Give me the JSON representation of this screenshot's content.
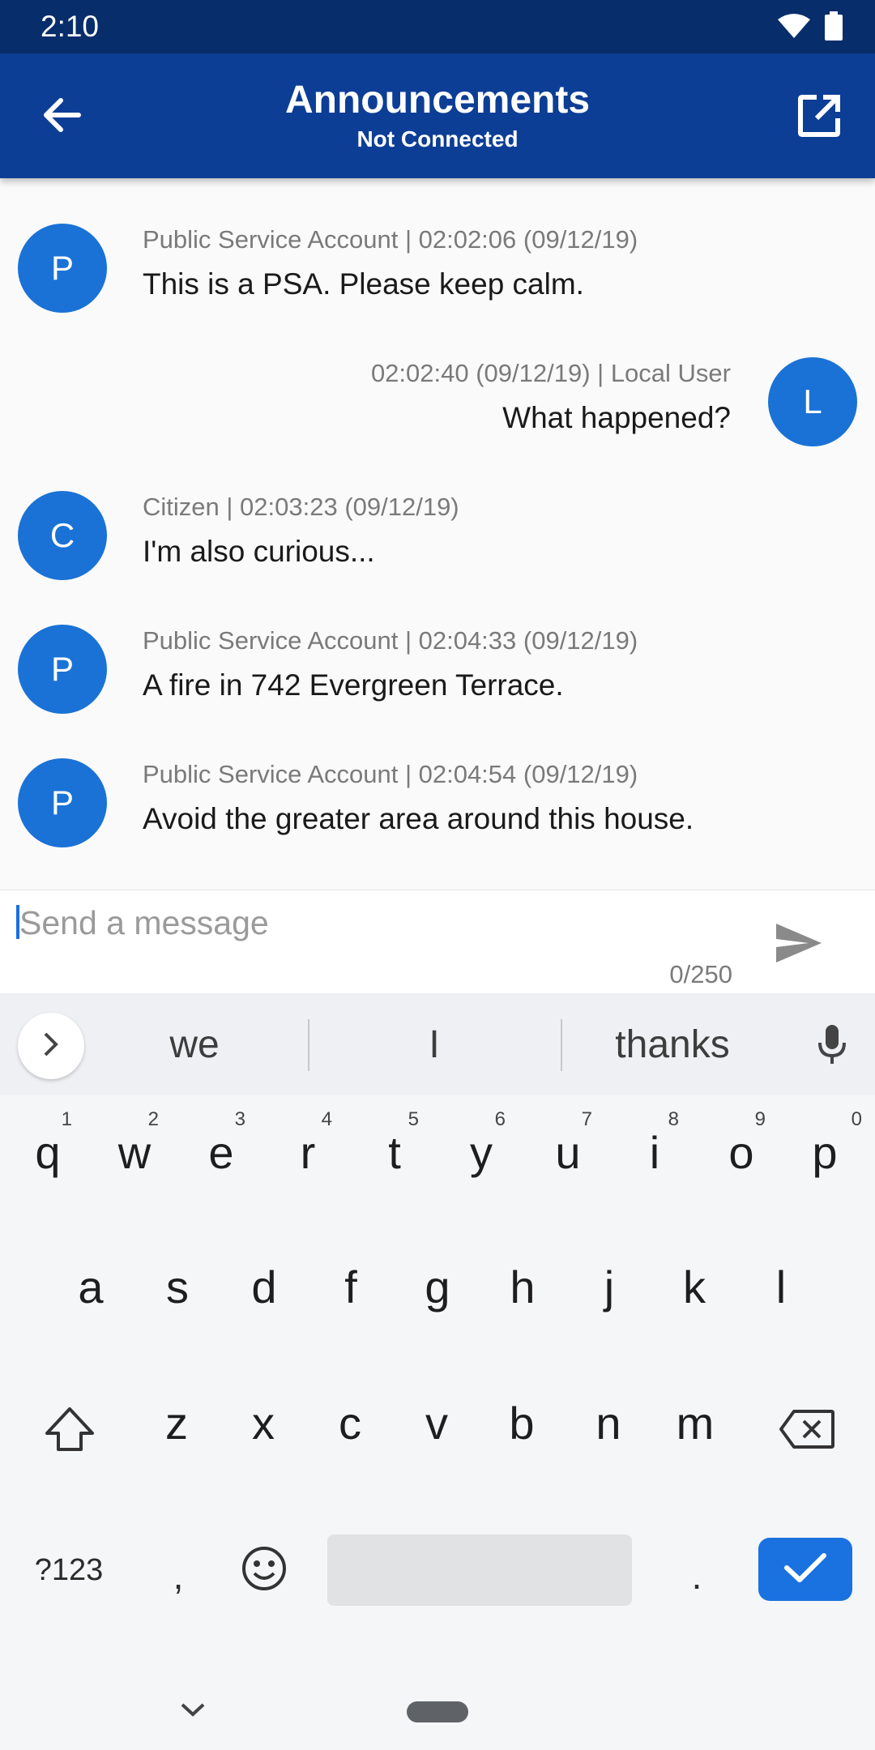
{
  "status_bar": {
    "time": "2:10"
  },
  "app_bar": {
    "title": "Announcements",
    "subtitle": "Not Connected"
  },
  "messages": [
    {
      "side": "left",
      "avatar": "P",
      "meta": "Public Service Account | 02:02:06 (09/12/19)",
      "text": "This is a PSA. Please keep calm."
    },
    {
      "side": "right",
      "avatar": "L",
      "meta": "02:02:40 (09/12/19) | Local User",
      "text": "What happened?"
    },
    {
      "side": "left",
      "avatar": "C",
      "meta": "Citizen | 02:03:23 (09/12/19)",
      "text": "I'm also curious..."
    },
    {
      "side": "left",
      "avatar": "P",
      "meta": "Public Service Account | 02:04:33 (09/12/19)",
      "text": "A fire in 742 Evergreen Terrace."
    },
    {
      "side": "left",
      "avatar": "P",
      "meta": "Public Service Account | 02:04:54 (09/12/19)",
      "text": "Avoid the greater area around this house."
    }
  ],
  "composer": {
    "placeholder": "Send a message",
    "value": "",
    "counter": "0/250"
  },
  "keyboard": {
    "suggestions": [
      "we",
      "I",
      "thanks"
    ],
    "row1": [
      "q",
      "w",
      "e",
      "r",
      "t",
      "y",
      "u",
      "i",
      "o",
      "p"
    ],
    "row1_numbers": [
      "1",
      "2",
      "3",
      "4",
      "5",
      "6",
      "7",
      "8",
      "9",
      "0"
    ],
    "row2": [
      "a",
      "s",
      "d",
      "f",
      "g",
      "h",
      "j",
      "k",
      "l"
    ],
    "row3": [
      "z",
      "x",
      "c",
      "v",
      "b",
      "n",
      "m"
    ],
    "symbols_label": "?123",
    "comma": ",",
    "period": "."
  },
  "colors": {
    "status_bar": "#082d6b",
    "app_bar": "#0d3e96",
    "avatar": "#1a72d6",
    "enter_key": "#1a72e0"
  }
}
